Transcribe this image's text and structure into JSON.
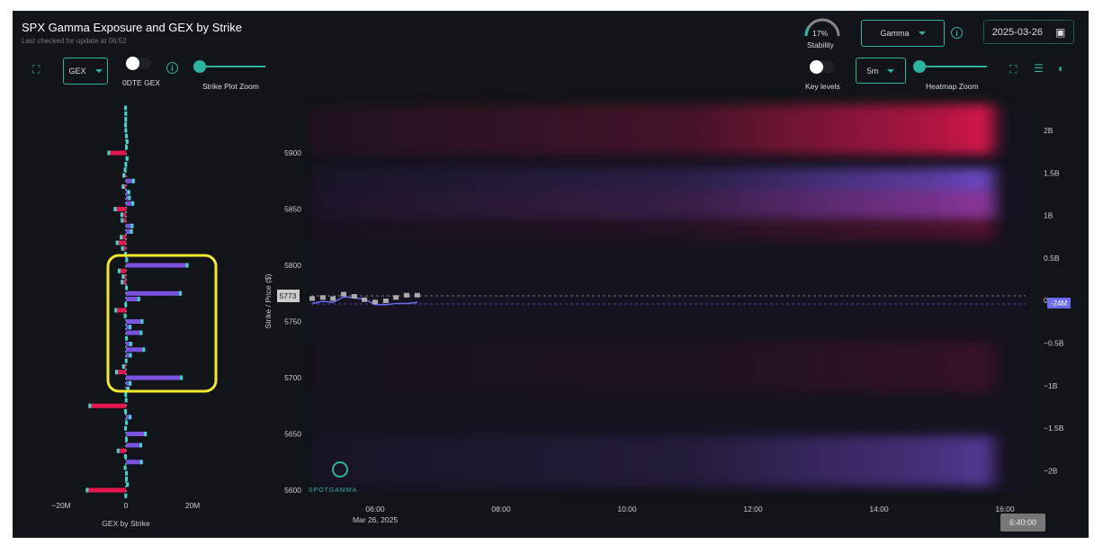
{
  "header": {
    "title": "SPX Gamma Exposure and GEX by Strike",
    "last_checked": "Last checked for update at 06:52"
  },
  "controls_left": {
    "mode_select": "GEX",
    "odte_label": "0DTE GEX",
    "strike_zoom_label": "Strike Plot Zoom"
  },
  "controls_right": {
    "stability_value": "17%",
    "stability_fraction": 0.17,
    "stability_label": "Stability",
    "metric_select": "Gamma",
    "date": "2025-03-26",
    "key_levels_label": "Key levels",
    "interval_select": "5m",
    "heatmap_zoom_label": "Heatmap Zoom"
  },
  "colors": {
    "accent": "#2bb5a0",
    "positive": "#7b52e0",
    "negative": "#e8174f",
    "spot_tick": "#41d6d0"
  },
  "chart_data": [
    {
      "type": "bar",
      "title": "GEX by Strike",
      "orientation": "horizontal",
      "x_ticks": [
        "−20M",
        "0",
        "20M"
      ],
      "xlim": [
        -24,
        27
      ],
      "units": "M",
      "strikes": [
        5940,
        5935,
        5930,
        5925,
        5920,
        5915,
        5910,
        5905,
        5900,
        5895,
        5890,
        5885,
        5880,
        5875,
        5870,
        5865,
        5860,
        5855,
        5850,
        5845,
        5840,
        5835,
        5830,
        5825,
        5820,
        5815,
        5810,
        5805,
        5800,
        5795,
        5790,
        5785,
        5780,
        5775,
        5770,
        5765,
        5760,
        5755,
        5750,
        5745,
        5740,
        5735,
        5730,
        5725,
        5720,
        5715,
        5710,
        5705,
        5700,
        5695,
        5690,
        5685,
        5680,
        5675,
        5670,
        5665,
        5660,
        5655,
        5650,
        5645,
        5640,
        5635,
        5630,
        5625,
        5620,
        5615,
        5610,
        5605,
        5600,
        5595
      ],
      "values": [
        0,
        0.1,
        -0.2,
        0,
        0.1,
        0.3,
        0.5,
        0.3,
        -5.3,
        0.5,
        0.1,
        -0.4,
        -0.8,
        2.4,
        -1.0,
        1.0,
        1.2,
        2.2,
        -3.4,
        -1.4,
        -1.3,
        2.0,
        1.8,
        -1.6,
        -2.8,
        -1.2,
        0,
        0.4,
        18.5,
        -2.2,
        -1.0,
        -1.3,
        0.3,
        16.5,
        4.0,
        -0.2,
        -3.2,
        -0.4,
        5.0,
        1.4,
        4.7,
        0.3,
        1.6,
        5.5,
        1.5,
        0.2,
        -0.9,
        -3.0,
        16.8,
        1.4,
        0.8,
        -0.2,
        0.2,
        -11.0,
        0,
        1.4,
        0.3,
        0,
        6.0,
        0.3,
        4.6,
        -2.5,
        0,
        4.8,
        -0.4,
        0.3,
        0.3,
        0.6,
        -11.8,
        -0.2
      ],
      "highlight_range": [
        5700,
        5805
      ]
    },
    {
      "type": "heatmap",
      "title": "SPX Gamma Exposure",
      "ylabel": "Strike / Price ($)",
      "ylim": [
        5593,
        5934
      ],
      "y_ticks": [
        5900,
        5850,
        5800,
        5750,
        5700,
        5650,
        5600
      ],
      "x_ticks": [
        "06:00",
        "08:00",
        "10:00",
        "12:00",
        "14:00",
        "16:00"
      ],
      "x_sublabel": "Mar 26, 2025",
      "xlim_hours": [
        4.98,
        16.33
      ],
      "right_ticks": [
        "2B",
        "1.5B",
        "1B",
        "0.5B",
        "0",
        "−0.5B",
        "−1B",
        "−1.5B",
        "−2B"
      ],
      "right_ylim_B": [
        -2.25,
        2.25
      ],
      "spot_price": "5773",
      "gex_marker": "-24M",
      "gex_marker_B": -0.024,
      "cursor_time": "6:40:00",
      "bands": [
        {
          "strike": 5921,
          "color": "#e8174f",
          "intensity": 0.9
        },
        {
          "strike": 5864,
          "color": "#7b52e0",
          "intensity": 0.85
        },
        {
          "strike": 5845,
          "color": "#c0134a",
          "intensity": 0.35
        },
        {
          "strike": 5626,
          "color": "#7b52e0",
          "intensity": 0.6
        },
        {
          "strike": 5710,
          "color": "#c0134a",
          "intensity": 0.2
        }
      ],
      "price_series": {
        "hours": [
          5.0,
          5.17,
          5.33,
          5.5,
          5.67,
          5.83,
          6.0,
          6.17,
          6.33,
          6.5,
          6.67
        ],
        "price": [
          5766,
          5768,
          5767,
          5772,
          5771,
          5770,
          5765,
          5765,
          5766,
          5766,
          5767
        ],
        "candle_close": [
          5770,
          5771,
          5770,
          5774,
          5772,
          5769,
          5767,
          5768,
          5771,
          5773,
          5773
        ]
      }
    }
  ]
}
